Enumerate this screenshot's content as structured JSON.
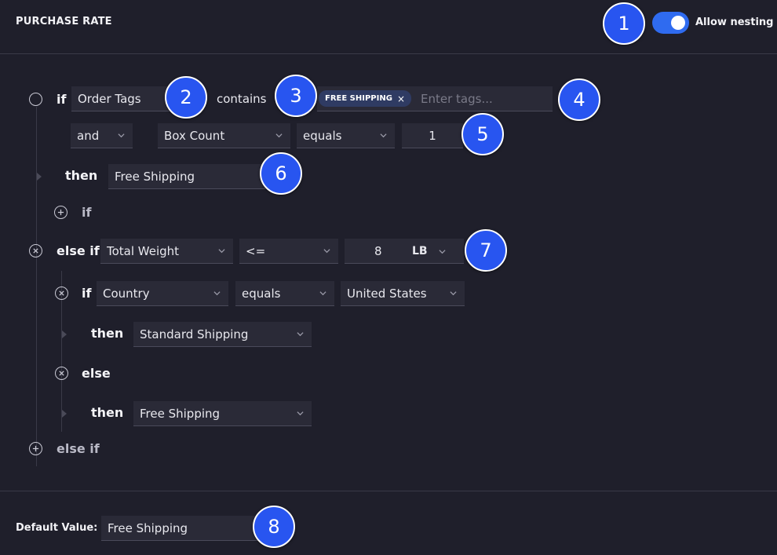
{
  "header": {
    "title": "PURCHASE RATE",
    "allow_nesting_label": "Allow nesting",
    "allow_nesting_on": true
  },
  "rule": {
    "if_kw": "if",
    "field1": "Order Tags",
    "operator1": "contains",
    "tag": "FREE SHIPPING",
    "tag_remove": "×",
    "tags_placeholder": "Enter tags...",
    "and_kw": "and",
    "field2": "Box Count",
    "operator2": "equals",
    "value2": "1",
    "then_kw": "then",
    "then_value": "Free Shipping",
    "add_if_kw": "if"
  },
  "else_if": {
    "kw": "else if",
    "field": "Total Weight",
    "operator": "<=",
    "value": "8",
    "unit": "LB",
    "nested": {
      "if_kw": "if",
      "field": "Country",
      "operator": "equals",
      "value": "United States",
      "then_kw": "then",
      "then_value": "Standard Shipping",
      "else_kw": "else",
      "else_then_kw": "then",
      "else_then_value": "Free Shipping"
    },
    "add_else_if_kw": "else if"
  },
  "footer": {
    "default_label": "Default Value:",
    "default_value": "Free Shipping"
  },
  "badges": [
    "1",
    "2",
    "3",
    "4",
    "5",
    "6",
    "7",
    "8"
  ],
  "colors": {
    "background": "#1f1f2b",
    "field": "#2a2a37",
    "accent": "#2f6bf0",
    "badge": "#2855f0",
    "chip": "#2f3b63"
  }
}
